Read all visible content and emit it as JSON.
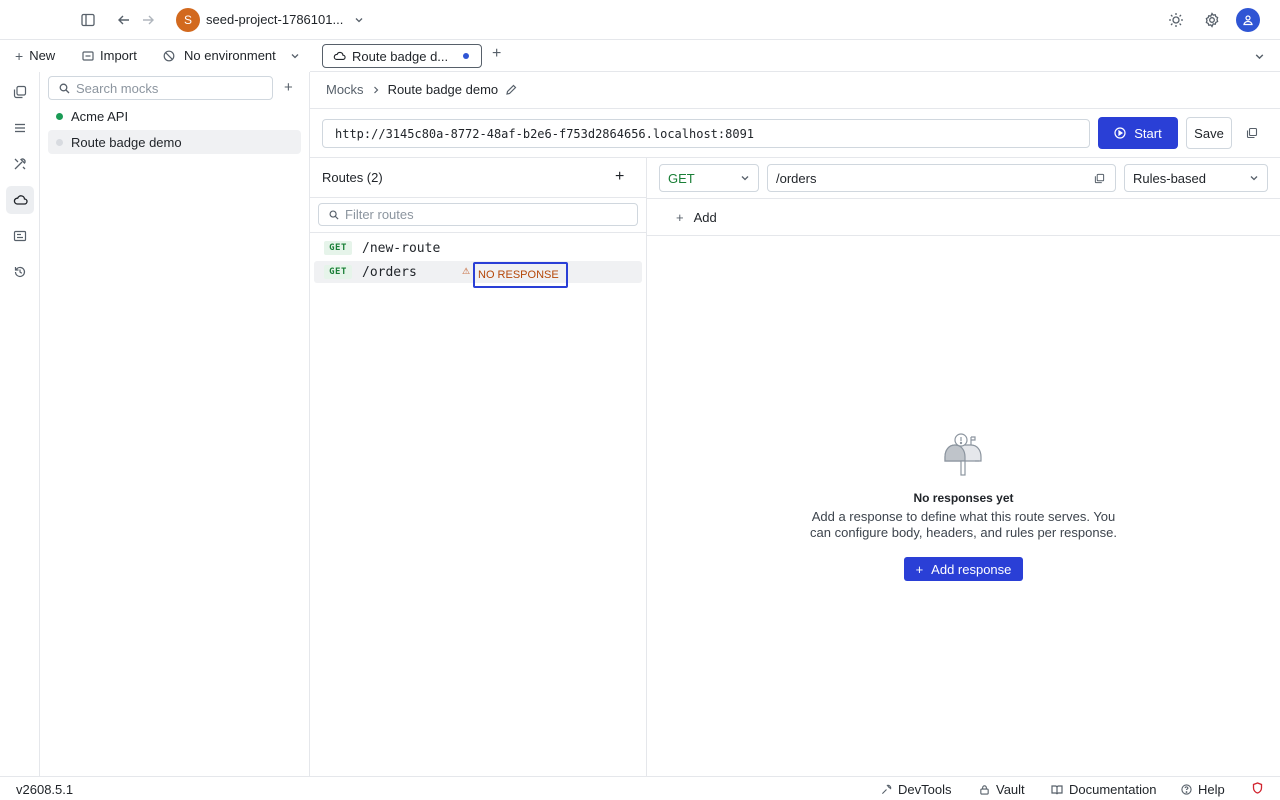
{
  "topbar": {
    "project_initial": "S",
    "project_name": "seed-project-1786101..."
  },
  "toolbar": {
    "new_label": "New",
    "import_label": "Import",
    "environment_label": "No environment"
  },
  "sidebar": {
    "search_placeholder": "Search mocks",
    "items": [
      {
        "label": "Acme API",
        "status_color": "#1a9b55"
      },
      {
        "label": "Route badge demo",
        "status_color": "#d8dbe0"
      }
    ]
  },
  "tabs": [
    {
      "label": "Route badge d..."
    }
  ],
  "breadcrumb": {
    "parent": "Mocks",
    "current": "Route badge demo"
  },
  "server": {
    "url": "http://3145c80a-8772-48af-b2e6-f753d2864656.localhost:8091",
    "start_label": "Start",
    "save_label": "Save"
  },
  "routes": {
    "title": "Routes (2)",
    "filter_placeholder": "Filter routes",
    "items": [
      {
        "method": "GET",
        "path": "/new-route"
      },
      {
        "method": "GET",
        "path": "/orders",
        "badge": "NO RESPONSE"
      }
    ]
  },
  "editor": {
    "method": "GET",
    "path": "/orders",
    "mode": "Rules-based",
    "add_label": "Add",
    "empty_title": "No responses yet",
    "empty_desc": "Add a response to define what this route serves. You can configure body, headers, and rules per response.",
    "add_response_label": "Add response"
  },
  "footer": {
    "version": "v2608.5.1",
    "devtools": "DevTools",
    "vault": "Vault",
    "documentation": "Documentation",
    "help": "Help"
  },
  "colors": {
    "accent": "#2a3fd6",
    "get_method": "#1a7f37",
    "warning": "#b54708"
  }
}
